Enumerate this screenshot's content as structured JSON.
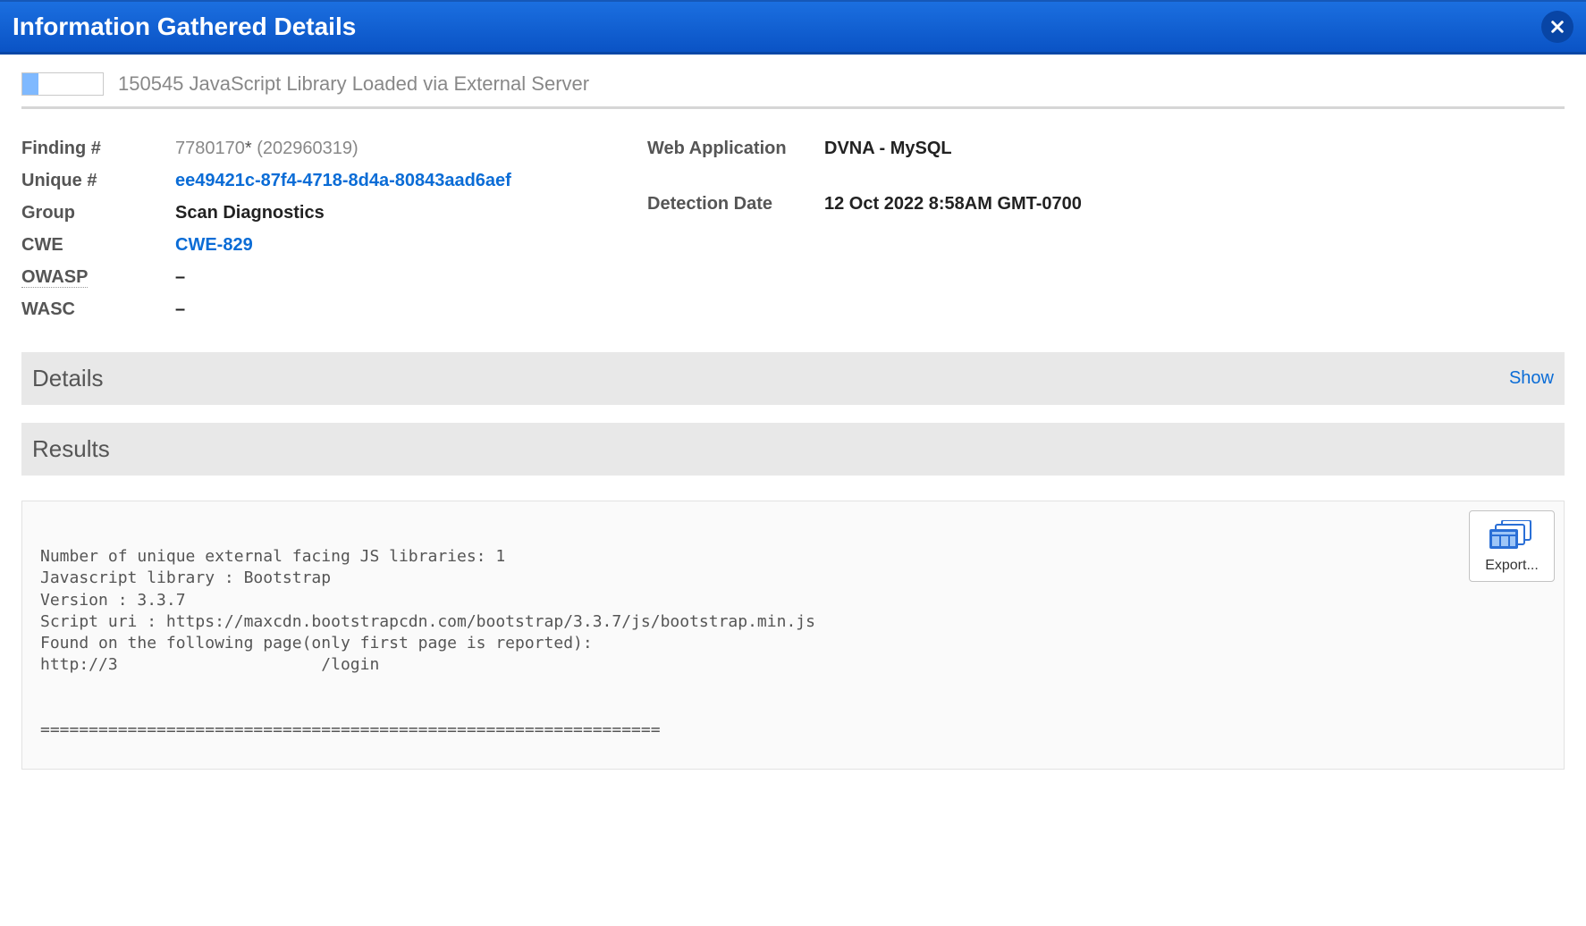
{
  "header": {
    "title": "Information Gathered Details"
  },
  "subtitle": {
    "qid_and_name": "150545 JavaScript Library Loaded via External Server"
  },
  "meta": {
    "finding_label": "Finding #",
    "finding_val": "7780170",
    "finding_star": "*",
    "finding_paren": " (202960319)",
    "unique_label": "Unique #",
    "unique_val": "ee49421c-87f4-4718-8d4a-80843aad6aef",
    "group_label": "Group",
    "group_val": "Scan Diagnostics",
    "cwe_label": "CWE",
    "cwe_val": "CWE-829",
    "owasp_label": "OWASP",
    "owasp_val": "–",
    "wasc_label": "WASC",
    "wasc_val": "–",
    "webapp_label": "Web Application",
    "webapp_val": "DVNA - MySQL",
    "detdate_label": "Detection Date",
    "detdate_val": "12 Oct 2022 8:58AM GMT-0700"
  },
  "sections": {
    "details_title": "Details",
    "details_show": "Show",
    "results_title": "Results"
  },
  "export_label": "Export...",
  "kb_text": "Number of unique external facing JS libraries: 1\nJavascript library : Bootstrap\nVersion : 3.3.7\nScript uri : https://maxcdn.bootstrapcdn.com/bootstrap/3.3.7/js/bootstrap.min.js\nFound on the following page(only first page is reported):\nhttp://3                     /login\n\n\n================================================================"
}
